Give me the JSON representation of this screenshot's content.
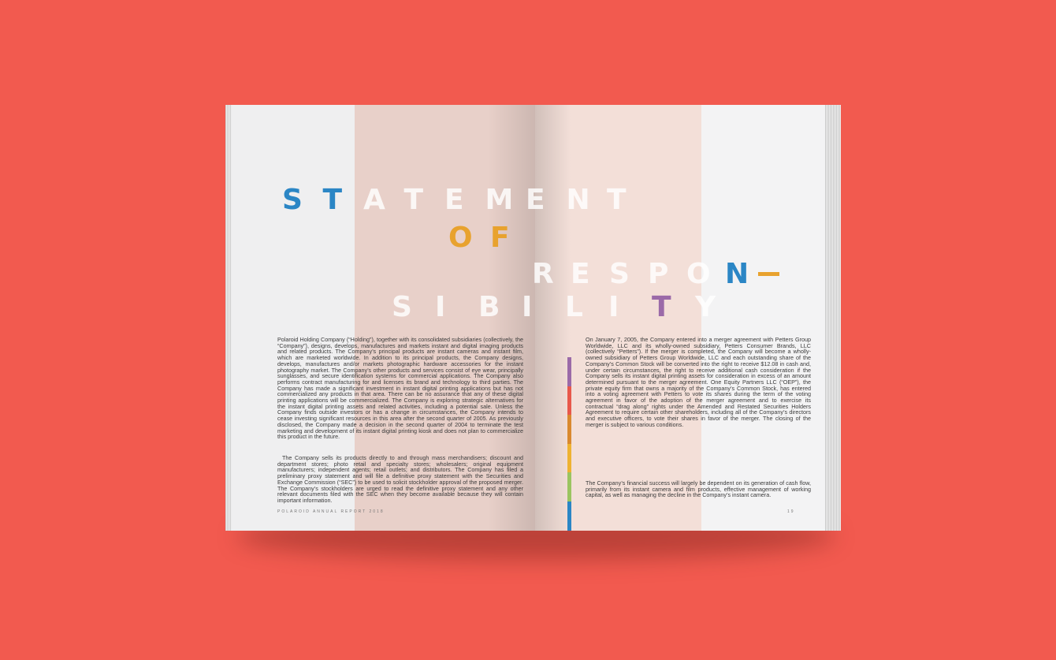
{
  "title": {
    "words": [
      "STATEMENT",
      "OF",
      "RESPON-",
      "SIBILITY"
    ]
  },
  "left_page": {
    "paragraph1": "Polaroid Holding Company (“Holding”), together with its consolidated subsidiaries (collectively, the “Company”), designs, develops, manufactures and markets instant and digital imaging products and related products. The Company’s principal products are instant cameras and instant film, which are marketed worldwide. In addition to its principal products, the Company designs, develops, manufactures and/or markets photographic hardware accessories for the instant photography market. The Company’s other products and services consist of eye wear, principally sunglasses, and secure identification systems for commercial applications. The Company also performs contract manufacturing for and licenses its brand and technology to third parties. The Company has made a significant investment in instant digital printing applications but has not commercialized any products in that area. There can be no assurance that any of these digital printing applications will be commercialized. The Company is exploring strategic alternatives for the instant digital printing assets and related activities, including a potential sale. Unless the Company finds outside investors or has a change in circumstances, the Company intends to cease investing significant resources in this area after the second quarter of 2005. As previously disclosed, the Company made a decision in the second quarter of 2004 to terminate the test marketing and development of its instant digital printing kiosk and does not plan to commercialize this product in the future.",
    "paragraph2": "The Company sells its products directly to and through mass merchandisers; discount and department stores; photo retail and specialty stores; wholesalers; original equipment manufacturers; independent agents; retail outlets; and distributors. The Company has filed a preliminary proxy statement and will file a definitive proxy statement with the Securities and Exchange Commission (“SEC”) to be used to solicit stockholder approval of the proposed merger. The Company’s stockholders are urged to read the definitive proxy statement and any other relevant documents filed with the SEC when they become available because they will contain important information.",
    "footer": "POLAROID ANNUAL REPORT 2018"
  },
  "right_page": {
    "paragraph1": "On January 7, 2005, the Company entered into a merger agreement with Petters Group Worldwide, LLC and its wholly-owned subsidiary, Petters Consumer Brands, LLC (collectively “Petters”). If the merger is completed, the Company will become a wholly-owned subsidiary of Petters Group Worldwide, LLC and each outstanding share of the Company’s Common Stock will be converted into the right to receive $12.08 in cash and, under certain circumstances, the right to receive additional cash consideration if the Company sells its instant digital printing assets for consideration in excess of an amount determined pursuant to the merger agreement. One Equity Partners LLC (“OEP”), the private equity firm that owns a majority of the Company’s Common Stock, has entered into a voting agreement with Petters to vote its shares during the term of the voting agreement in favor of the adoption of the merger agreement and to exercise its contractual “drag along” rights under the Amended and Restated Securities Holders Agreement to require certain other shareholders, including all of the Company’s directors and executive officers, to vote their shares in favor of the merger. The closing of the merger is subject to various conditions.",
    "paragraph2": "The Company’s financial success will largely be dependent on its generation of cash flow, primarily from its instant camera and film products, effective management of working capital, as well as managing the decline in the Company’s instant camera.",
    "page_number": "19"
  },
  "colors": {
    "background": "#f25a4f",
    "accent_blue": "#2b86c5",
    "accent_orange": "#e8a22e",
    "accent_purple": "#9b6aa8",
    "color_bar": [
      "#9b6aa8",
      "#e8584b",
      "#d9892f",
      "#eeb232",
      "#9bc460",
      "#2b86c5"
    ]
  }
}
